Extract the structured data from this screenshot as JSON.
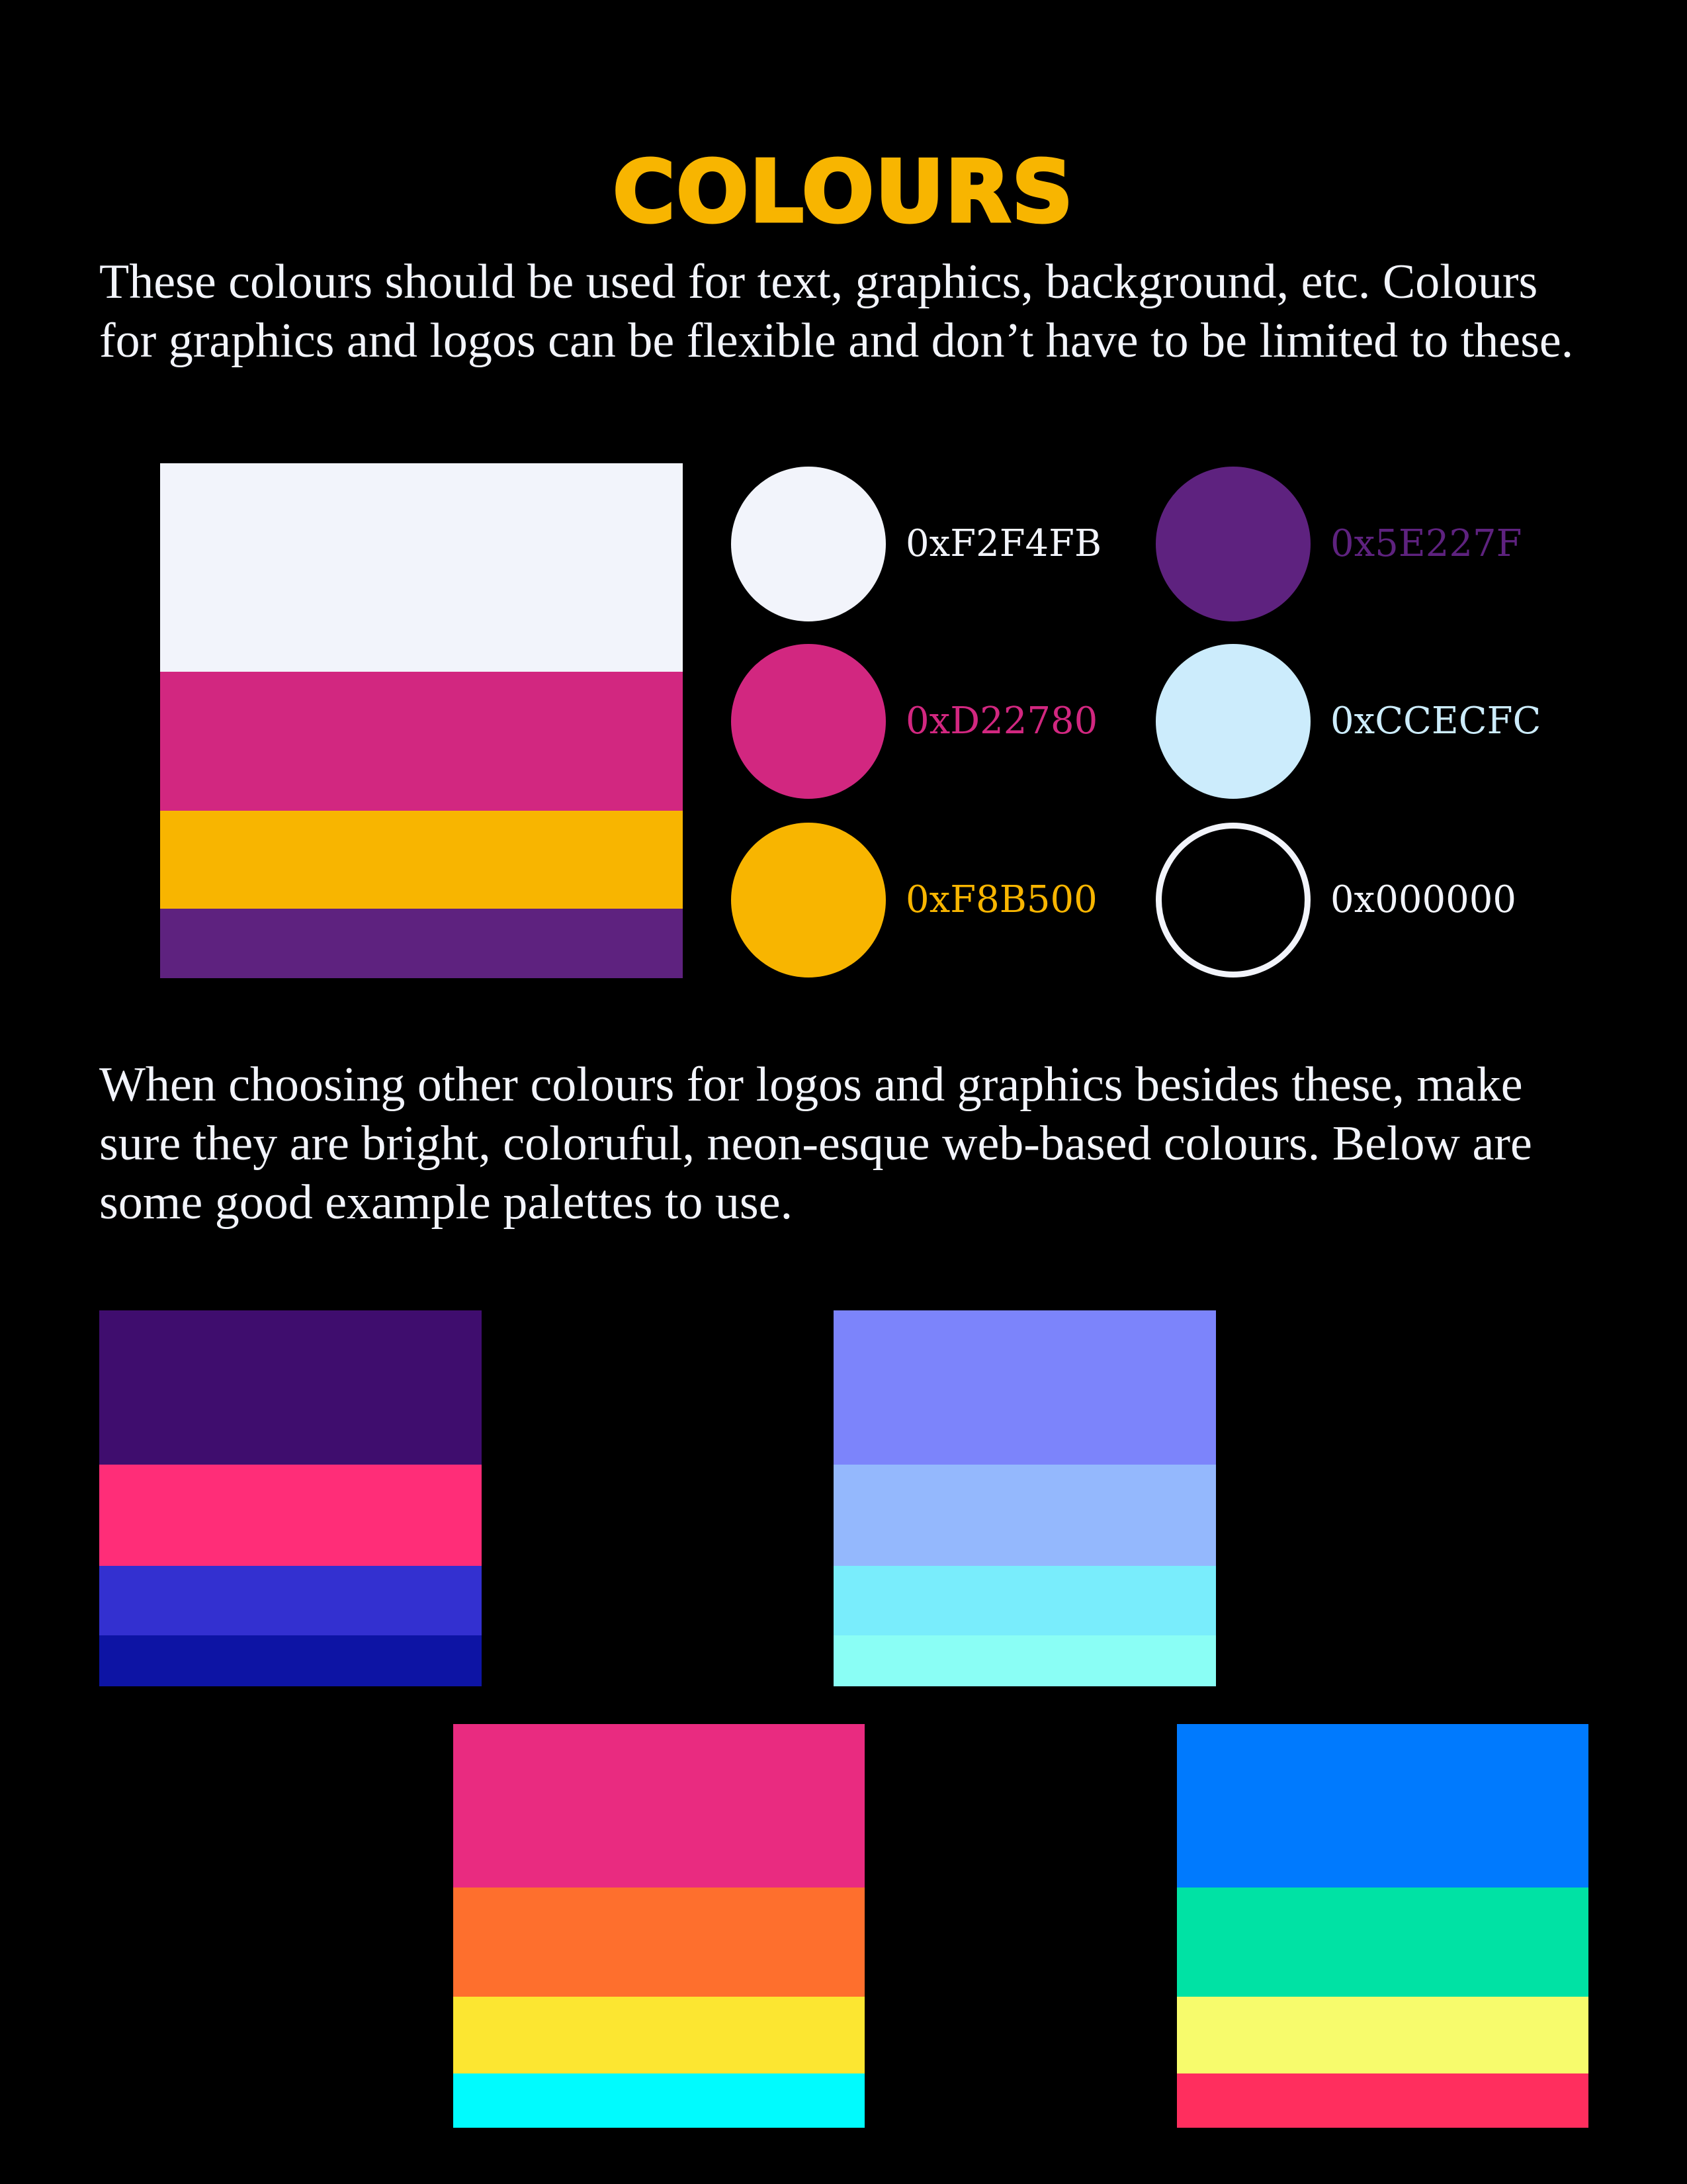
{
  "title": "COLOURS",
  "intro_text": "These colours should be used for text, graphics, background, etc. Colours for graphics and logos can be flexible and don’t have to be limited to these.",
  "main_palette": [
    {
      "color": "#F2F4FB",
      "share": 0.405
    },
    {
      "color": "#D22780",
      "share": 0.27
    },
    {
      "color": "#F8B500",
      "share": 0.19
    },
    {
      "color": "#5E227F",
      "share": 0.135
    }
  ],
  "swatches": [
    {
      "hex": "0xF2F4FB",
      "color": "#F2F4FB",
      "label_color": "#F2F4FB",
      "outlined": false
    },
    {
      "hex": "0x5E227F",
      "color": "#5E227F",
      "label_color": "#5E227F",
      "outlined": false
    },
    {
      "hex": "0xD22780",
      "color": "#D22780",
      "label_color": "#D22780",
      "outlined": false
    },
    {
      "hex": "0xCCECFC",
      "color": "#CCECFC",
      "label_color": "#CCECFC",
      "outlined": false
    },
    {
      "hex": "0xF8B500",
      "color": "#F8B500",
      "label_color": "#F8B500",
      "outlined": false
    },
    {
      "hex": "0x000000",
      "color": "#000000",
      "label_color": "#F2F4FB",
      "outlined": true
    }
  ],
  "outro_text": "When choosing other colours for logos and graphics besides these, make sure they are bright, coloruful, neon-esque web-based colours. Below are some good example palettes to use.",
  "example_palettes": [
    {
      "bands": [
        {
          "color": "#3F0D6E",
          "share": 0.41
        },
        {
          "color": "#FF2D78",
          "share": 0.27
        },
        {
          "color": "#3330D0",
          "share": 0.185
        },
        {
          "color": "#0D14A4",
          "share": 0.135
        }
      ]
    },
    {
      "bands": [
        {
          "color": "#7C84FB",
          "share": 0.41
        },
        {
          "color": "#94B8FD",
          "share": 0.27
        },
        {
          "color": "#79EDFC",
          "share": 0.185
        },
        {
          "color": "#8AFEF5",
          "share": 0.135
        }
      ]
    },
    {
      "bands": [
        {
          "color": "#E92B80",
          "share": 0.405
        },
        {
          "color": "#FE6F2D",
          "share": 0.27
        },
        {
          "color": "#FCE631",
          "share": 0.19
        },
        {
          "color": "#00FBFE",
          "share": 0.135
        }
      ]
    },
    {
      "bands": [
        {
          "color": "#007AFE",
          "share": 0.405
        },
        {
          "color": "#00E2A4",
          "share": 0.27
        },
        {
          "color": "#F7FB6C",
          "share": 0.19
        },
        {
          "color": "#FF2E5E",
          "share": 0.135
        }
      ]
    }
  ]
}
